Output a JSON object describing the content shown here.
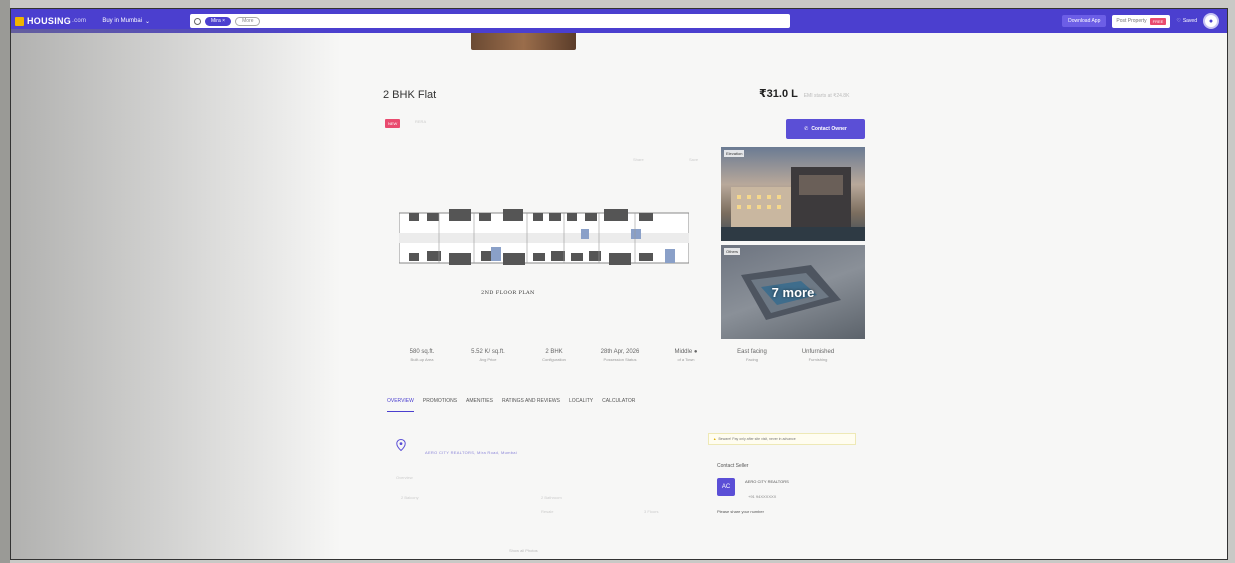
{
  "header": {
    "logo_text": "HOUSING",
    "logo_suffix": ".com",
    "buy_label": "Buy in Mumbai",
    "search_chip": "Mira",
    "search_more": "More",
    "download_app": "Download App",
    "post_property": "Post Property",
    "free_badge": "FREE",
    "saved": "Saved"
  },
  "listing": {
    "title": "2 BHK Flat",
    "price": "₹31.0 L",
    "price_sub": "EMI starts at ₹24.8K",
    "new_tag": "NEW",
    "tag_sub": "RERA",
    "contact_owner": "Contact Owner",
    "share_label": "Share",
    "save_label": "Save",
    "floorplan_label": "2ND FLOOR PLAN",
    "photo_tag_1": "Elevation",
    "photo_tag_2": "Others",
    "more_photos": "7 more"
  },
  "stats": [
    {
      "value": "580 sq.ft.",
      "label": "Built-up Area"
    },
    {
      "value": "5.52 K/ sq.ft.",
      "label": "Avg Price"
    },
    {
      "value": "2 BHK",
      "label": "Configuration"
    },
    {
      "value": "28th Apr, 2026",
      "label": "Possession Status"
    },
    {
      "value": "Middle",
      "label": "of a Town"
    },
    {
      "value": "East facing",
      "label": "Facing"
    },
    {
      "value": "Unfurnished",
      "label": "Furnishing"
    }
  ],
  "tabs": [
    "OVERVIEW",
    "PROMOTIONS",
    "AMENITIES",
    "RATINGS AND REVIEWS",
    "LOCALITY",
    "CALCULATOR"
  ],
  "overview": {
    "address": "AERO CITY REALTORS, Mira Road, Mumbai",
    "warning": "Beware! Pay only after site visit, never in advance",
    "contact_seller": "Contact Seller",
    "seller_initials": "AC",
    "seller_name": "AERO CITY REALTORS",
    "seller_phone": "+91 94XXXXXX",
    "share_number": "Please share your number",
    "row_label": "Overview",
    "row_a": "2 Balcony",
    "row_b": "2 Bathroom",
    "row_c": "Resale",
    "row_d": "3 Floors",
    "footer_link": "Show all Photos"
  }
}
